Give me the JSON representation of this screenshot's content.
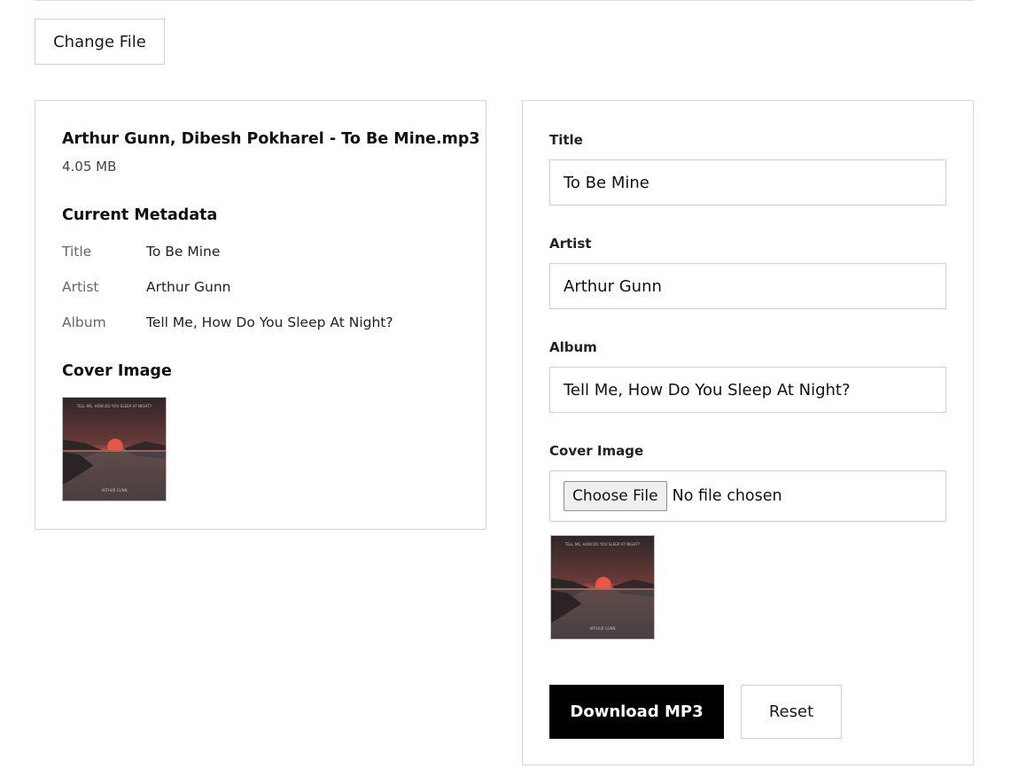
{
  "toolbar": {
    "change_file_label": "Change File"
  },
  "file": {
    "name": "Arthur Gunn, Dibesh Pokharel - To Be Mine.mp3",
    "size": "4.05 MB"
  },
  "current_metadata": {
    "heading": "Current Metadata",
    "rows": [
      {
        "key": "Title",
        "value": "To Be Mine"
      },
      {
        "key": "Artist",
        "value": "Arthur Gunn"
      },
      {
        "key": "Album",
        "value": "Tell Me, How Do You Sleep At Night?"
      }
    ],
    "cover_heading": "Cover Image"
  },
  "cover_art": {
    "top_text": "TELL ME, HOW DO YOU SLEEP AT NIGHT?",
    "bottom_text": "ARTHUR GUNN",
    "sun_color": "#e8584a",
    "sky_color": "#3a2a2c"
  },
  "form": {
    "title_label": "Title",
    "title_value": "To Be Mine",
    "artist_label": "Artist",
    "artist_value": "Arthur Gunn",
    "album_label": "Album",
    "album_value": "Tell Me, How Do You Sleep At Night?",
    "cover_label": "Cover Image",
    "choose_file_label": "Choose File",
    "no_file_text": "No file chosen",
    "download_label": "Download MP3",
    "reset_label": "Reset"
  },
  "colors": {
    "primary_button": "#000000",
    "border": "#cfcfcf"
  }
}
